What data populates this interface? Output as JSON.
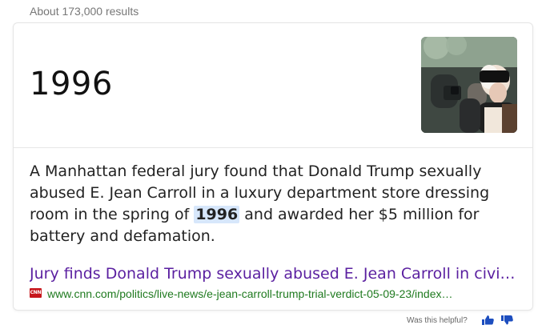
{
  "results": {
    "count_text": "About 173,000 results"
  },
  "answer": {
    "value": "1996",
    "text_before": "A Manhattan federal jury found that Donald Trump sexually abused E. Jean Carroll in a luxury department store dressing room in the spring of ",
    "highlight": "1996",
    "text_after": " and awarded her $5 million for battery and defamation."
  },
  "source": {
    "title": "Jury finds Donald Trump sexually abused E. Jean Carroll in civil cas…",
    "url": "www.cnn.com/politics/live-news/e-jean-carroll-trump-trial-verdict-05-09-23/index…",
    "favicon_text": "CNN",
    "favicon_color": "#c7161b",
    "title_color": "#5a1fa0",
    "url_color": "#1f7a1f"
  },
  "feedback": {
    "label": "Was this helpful?",
    "thumbs_up_icon": "thumbs-up-icon",
    "thumbs_down_icon": "thumbs-down-icon",
    "icon_color": "#1d4ebf"
  }
}
